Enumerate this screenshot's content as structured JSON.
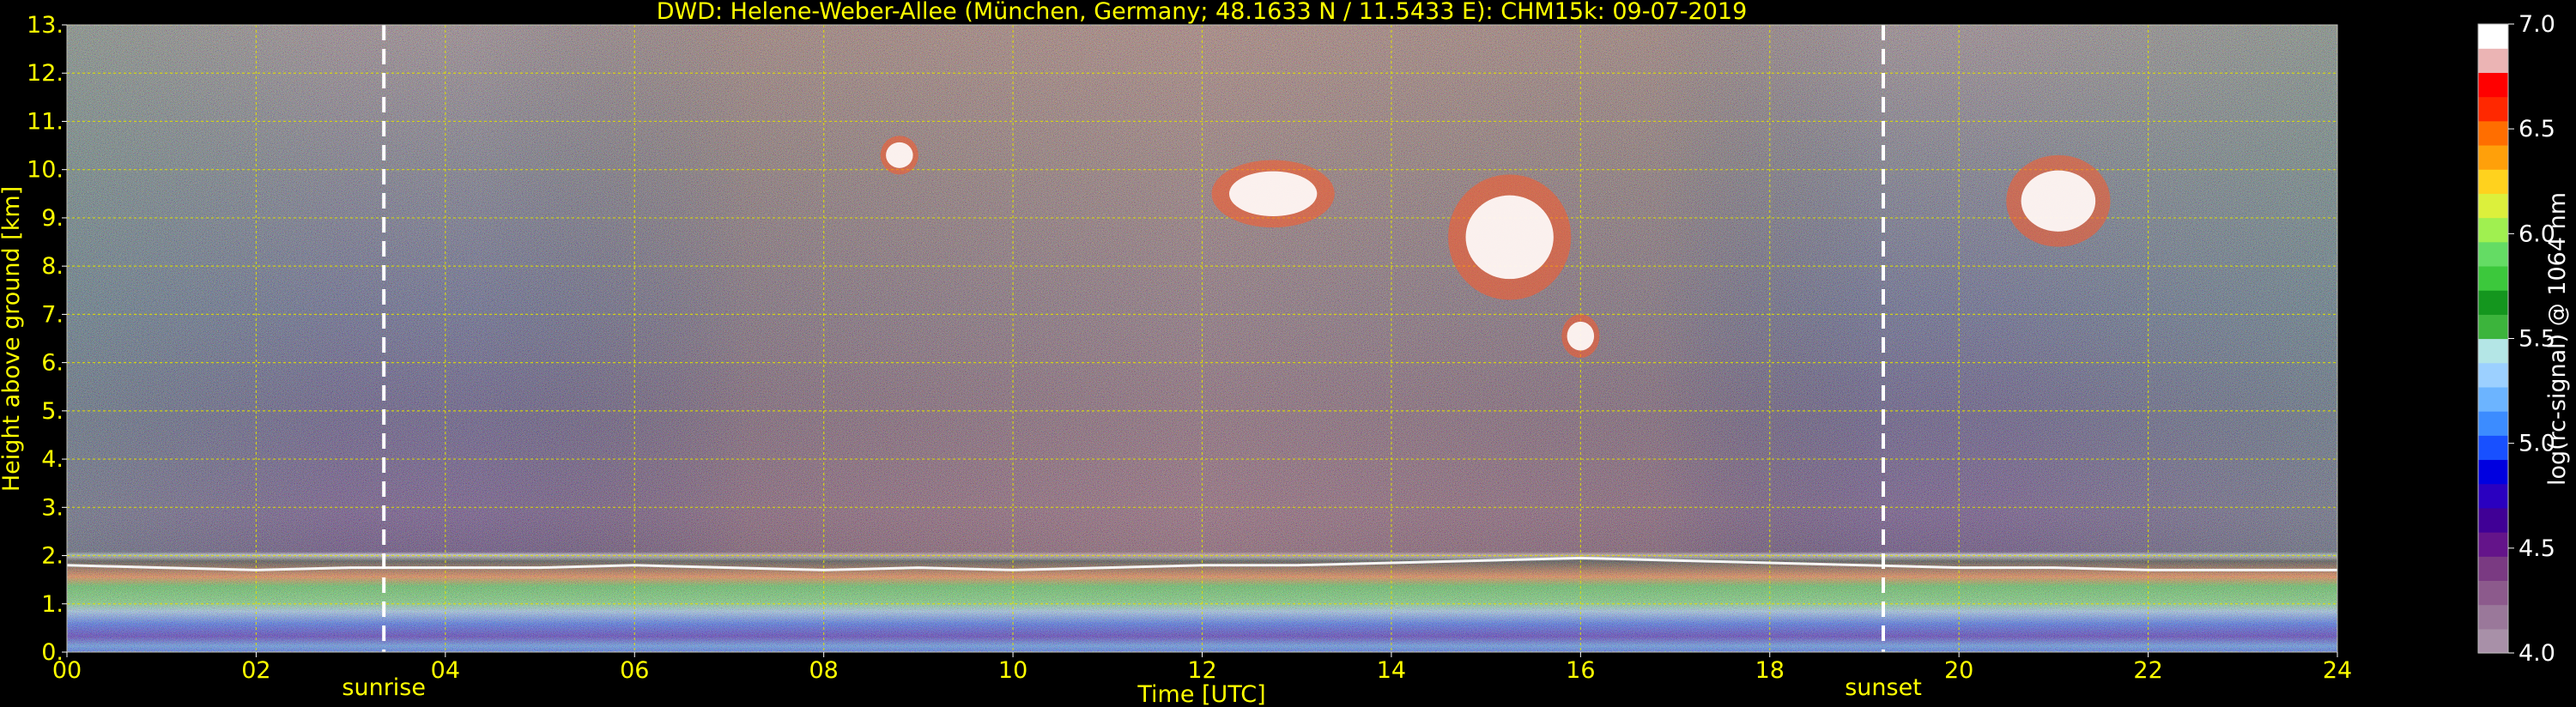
{
  "chart_data": {
    "type": "heatmap",
    "title": "DWD: Helene-Weber-Allee (München, Germany; 48.1633 N / 11.5433 E):    CHM15k: 09-07-2019",
    "xlabel": "Time [UTC]",
    "ylabel": "Height above ground [km]",
    "xlim": [
      0,
      24
    ],
    "ylim": [
      0,
      13
    ],
    "x_ticks": [
      "00",
      "02",
      "04",
      "06",
      "08",
      "10",
      "12",
      "14",
      "16",
      "18",
      "20",
      "22",
      "24"
    ],
    "y_ticks": [
      "0.",
      "1.",
      "2.",
      "3.",
      "4.",
      "5.",
      "6.",
      "7.",
      "8.",
      "9.",
      "10.",
      "11.",
      "12.",
      "13."
    ],
    "grid": true,
    "annotations": [
      {
        "label": "sunrise",
        "x": 3.35
      },
      {
        "label": "sunset",
        "x": 19.2
      }
    ],
    "colorbar": {
      "label": "log(rc-signal) @ 1064 nm",
      "range": [
        4.0,
        7.0
      ],
      "ticks": [
        "4.0",
        "4.5",
        "5.0",
        "5.5",
        "6.0",
        "6.5",
        "7.0"
      ],
      "colors": [
        "#a890a8",
        "#9a789a",
        "#8c5a8c",
        "#7a3a82",
        "#64148a",
        "#400096",
        "#2a00c0",
        "#0000e0",
        "#1850ff",
        "#3c8cff",
        "#6cb4ff",
        "#9cd0ff",
        "#b4e6e6",
        "#3cb43c",
        "#14961e",
        "#3cc83c",
        "#64dc64",
        "#a0f050",
        "#dcf03c",
        "#ffd21e",
        "#ffa00a",
        "#ff6e00",
        "#ff2800",
        "#ff0000",
        "#ebb4b4",
        "#ffffff"
      ]
    },
    "series": [
      {
        "name": "boundary layer top",
        "x": [
          0,
          1,
          2,
          3,
          4,
          5,
          6,
          7,
          8,
          9,
          10,
          11,
          12,
          13,
          14,
          15,
          16,
          17,
          18,
          19,
          20,
          21,
          22,
          23,
          24
        ],
        "values": [
          1.8,
          1.75,
          1.7,
          1.75,
          1.75,
          1.75,
          1.8,
          1.75,
          1.7,
          1.75,
          1.7,
          1.75,
          1.8,
          1.8,
          1.85,
          1.9,
          1.95,
          1.9,
          1.85,
          1.8,
          1.75,
          1.75,
          1.7,
          1.7,
          1.7
        ]
      },
      {
        "name": "cloud layers",
        "points": [
          {
            "x0": 8.6,
            "x1": 9.0,
            "y0": 9.9,
            "y1": 10.7
          },
          {
            "x0": 12.1,
            "x1": 13.4,
            "y0": 8.8,
            "y1": 10.2
          },
          {
            "x0": 14.6,
            "x1": 15.9,
            "y0": 7.3,
            "y1": 9.9
          },
          {
            "x0": 15.8,
            "x1": 16.2,
            "y0": 6.1,
            "y1": 7.0
          },
          {
            "x0": 20.5,
            "x1": 21.6,
            "y0": 8.4,
            "y1": 10.3
          }
        ]
      }
    ]
  }
}
